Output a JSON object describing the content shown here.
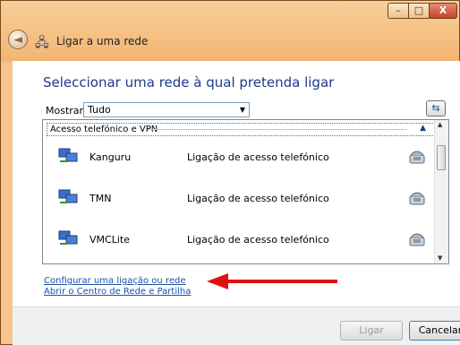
{
  "window": {
    "title": "Ligar a uma rede",
    "controls": {
      "minimize": "–",
      "maximize": "□",
      "close": "X"
    }
  },
  "main": {
    "heading": "Seleccionar uma rede à qual pretenda ligar",
    "filter": {
      "label": "Mostrar",
      "value": "Tudo"
    }
  },
  "list": {
    "group_label": "Acesso telefónico e VPN",
    "items": [
      {
        "name": "Kanguru",
        "type": "Ligação de acesso telefónico"
      },
      {
        "name": "TMN",
        "type": "Ligação de acesso telefónico"
      },
      {
        "name": "VMCLite",
        "type": "Ligação de acesso telefónico"
      }
    ]
  },
  "links": {
    "configure": "Configurar uma ligação ou rede",
    "open_center": "Abrir o Centro de Rede e Partilha"
  },
  "buttons": {
    "connect": "Ligar",
    "cancel": "Cancelar"
  },
  "colors": {
    "chrome": "#f3b572",
    "heading": "#1e3a8a",
    "link": "#1a52a8",
    "arrow": "#e01010"
  }
}
